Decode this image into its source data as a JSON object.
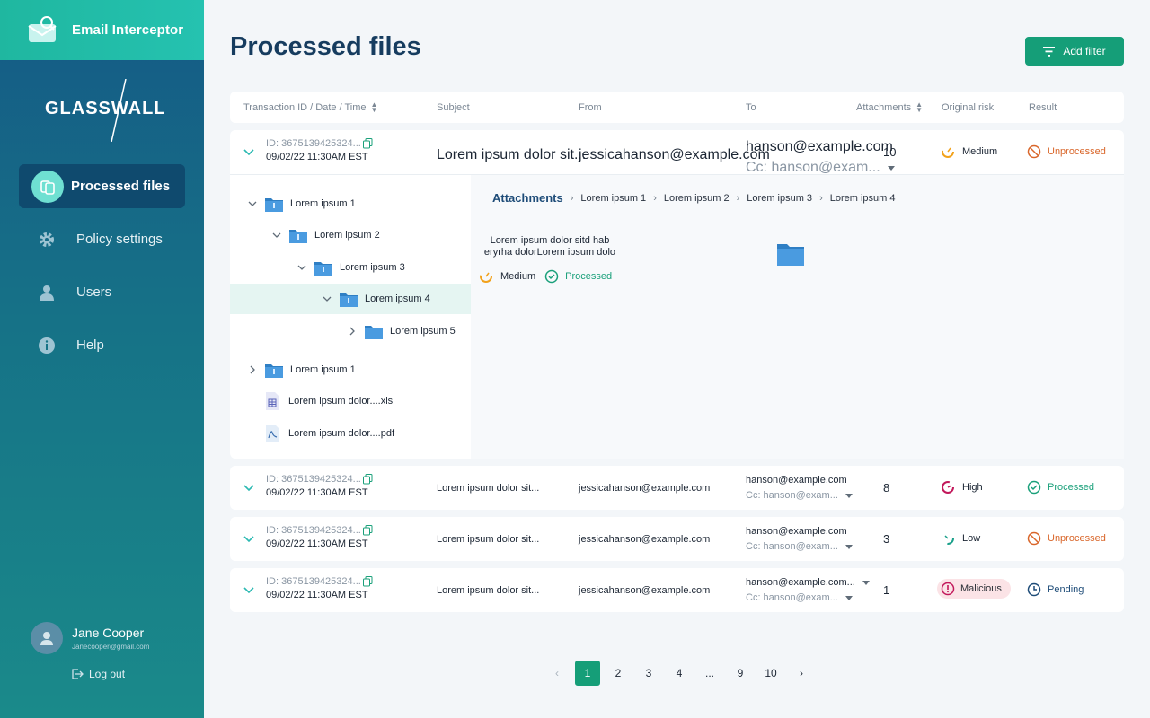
{
  "app": {
    "title": "Email Interceptor",
    "logo_text": "GLASSWALL"
  },
  "nav": [
    {
      "label": "Processed files",
      "icon": "files-icon",
      "active": true
    },
    {
      "label": "Policy settings",
      "icon": "gear-icon",
      "active": false
    },
    {
      "label": "Users",
      "icon": "user-icon",
      "active": false
    },
    {
      "label": "Help",
      "icon": "info-icon",
      "active": false
    }
  ],
  "user": {
    "name": "Jane Cooper",
    "email": "Janecooper@gmail.com",
    "logout": "Log out"
  },
  "page": {
    "title": "Processed files",
    "add_filter": "Add filter"
  },
  "columns": {
    "transaction": "Transaction ID / Date / Time",
    "subject": "Subject",
    "from": "From",
    "to": "To",
    "attachments": "Attachments",
    "risk": "Original risk",
    "result": "Result"
  },
  "rows": [
    {
      "id": "ID: 3675139425324...",
      "date": "09/02/22 11:30AM EST",
      "subject": "Lorem ipsum dolor sit...",
      "from": "jessicahanson@example.com",
      "to": "hanson@example.com",
      "cc": "Cc: hanson@exam...",
      "attachments": "10",
      "risk": "Medium",
      "result": "Unprocessed"
    },
    {
      "id": "ID: 3675139425324...",
      "date": "09/02/22 11:30AM EST",
      "subject": "Lorem ipsum dolor sit...",
      "from": "jessicahanson@example.com",
      "to": "hanson@example.com",
      "cc": "Cc: hanson@exam...",
      "attachments": "8",
      "risk": "High",
      "result": "Processed"
    },
    {
      "id": "ID: 3675139425324...",
      "date": "09/02/22 11:30AM EST",
      "subject": "Lorem ipsum dolor sit...",
      "from": "jessicahanson@example.com",
      "to": "hanson@example.com",
      "cc": "Cc: hanson@exam...",
      "attachments": "3",
      "risk": "Low",
      "result": "Unprocessed"
    },
    {
      "id": "ID: 3675139425324...",
      "date": "09/02/22 11:30AM EST",
      "subject": "Lorem ipsum dolor sit...",
      "from": "jessicahanson@example.com",
      "to": "hanson@example.com...",
      "cc": "Cc: hanson@exam...",
      "attachments": "1",
      "risk": "Malicious",
      "result": "Pending"
    }
  ],
  "tree": [
    {
      "label": "Lorem ipsum 1"
    },
    {
      "label": "Lorem ipsum 2"
    },
    {
      "label": "Lorem ipsum 3"
    },
    {
      "label": "Lorem ipsum 4"
    },
    {
      "label": "Lorem ipsum 5"
    },
    {
      "label": "Lorem ipsum 1"
    },
    {
      "label": "Lorem ipsum dolor....xls"
    },
    {
      "label": "Lorem ipsum dolor....pdf"
    }
  ],
  "detail": {
    "crumbs": [
      "Attachments",
      "Lorem ipsum 1",
      "Lorem ipsum 2",
      "Lorem ipsum 3",
      "Lorem ipsum 4"
    ],
    "desc_1": "Lorem ipsum dolor sitd hab",
    "desc_2": "eryrha dolorLorem ipsum dolo",
    "risk": "Medium",
    "result": "Processed"
  },
  "pagination": {
    "pages": [
      "1",
      "2",
      "3",
      "4",
      "...",
      "9",
      "10"
    ],
    "current": "1"
  },
  "colors": {
    "accent": "#159e78",
    "medium": "#f2a21c",
    "high": "#c2185b",
    "low": "#1aa08a",
    "unprocessed": "#d9662a",
    "processed": "#1aa07a",
    "pending": "#1e4c78"
  }
}
